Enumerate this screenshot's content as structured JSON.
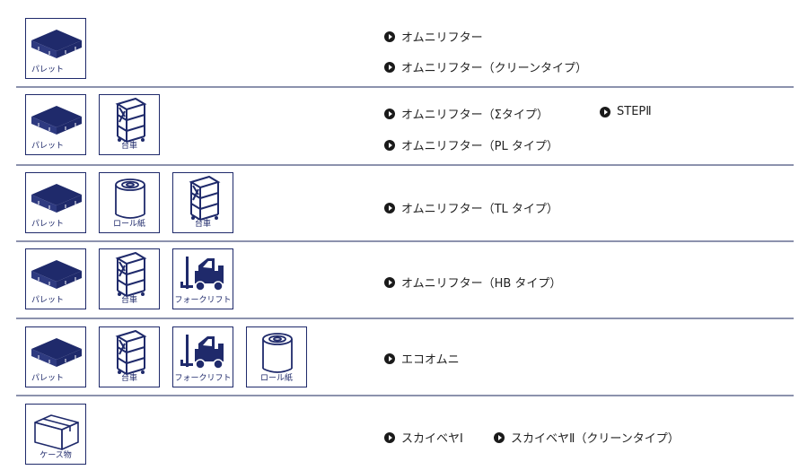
{
  "labels": {
    "pallet": "パレット",
    "cart": "台車",
    "roll": "ロール紙",
    "forklift": "フォークリフト",
    "case": "ケース物"
  },
  "rows": [
    {
      "links": [
        "オムニリフター",
        "オムニリフター（クリーンタイプ）"
      ]
    },
    {
      "links": [
        "オムニリフター（Σタイプ）",
        "STEPⅡ",
        "オムニリフター（PL タイプ）"
      ]
    },
    {
      "links": [
        "オムニリフター（TL タイプ）"
      ]
    },
    {
      "links": [
        "オムニリフター（HB タイプ）"
      ]
    },
    {
      "links": [
        "エコオムニ"
      ]
    },
    {
      "links": [
        "スカイベヤⅠ",
        "スカイベヤⅡ（クリーンタイプ）"
      ]
    }
  ],
  "colors": {
    "icon": "#1f2a6b",
    "divider": "#8c92ad",
    "bullet": "#1a1a1a"
  },
  "icon_names": [
    "pallet-icon",
    "cart-icon",
    "roll-paper-icon",
    "forklift-icon",
    "cardboard-box-icon",
    "arrow-bullet-icon"
  ]
}
